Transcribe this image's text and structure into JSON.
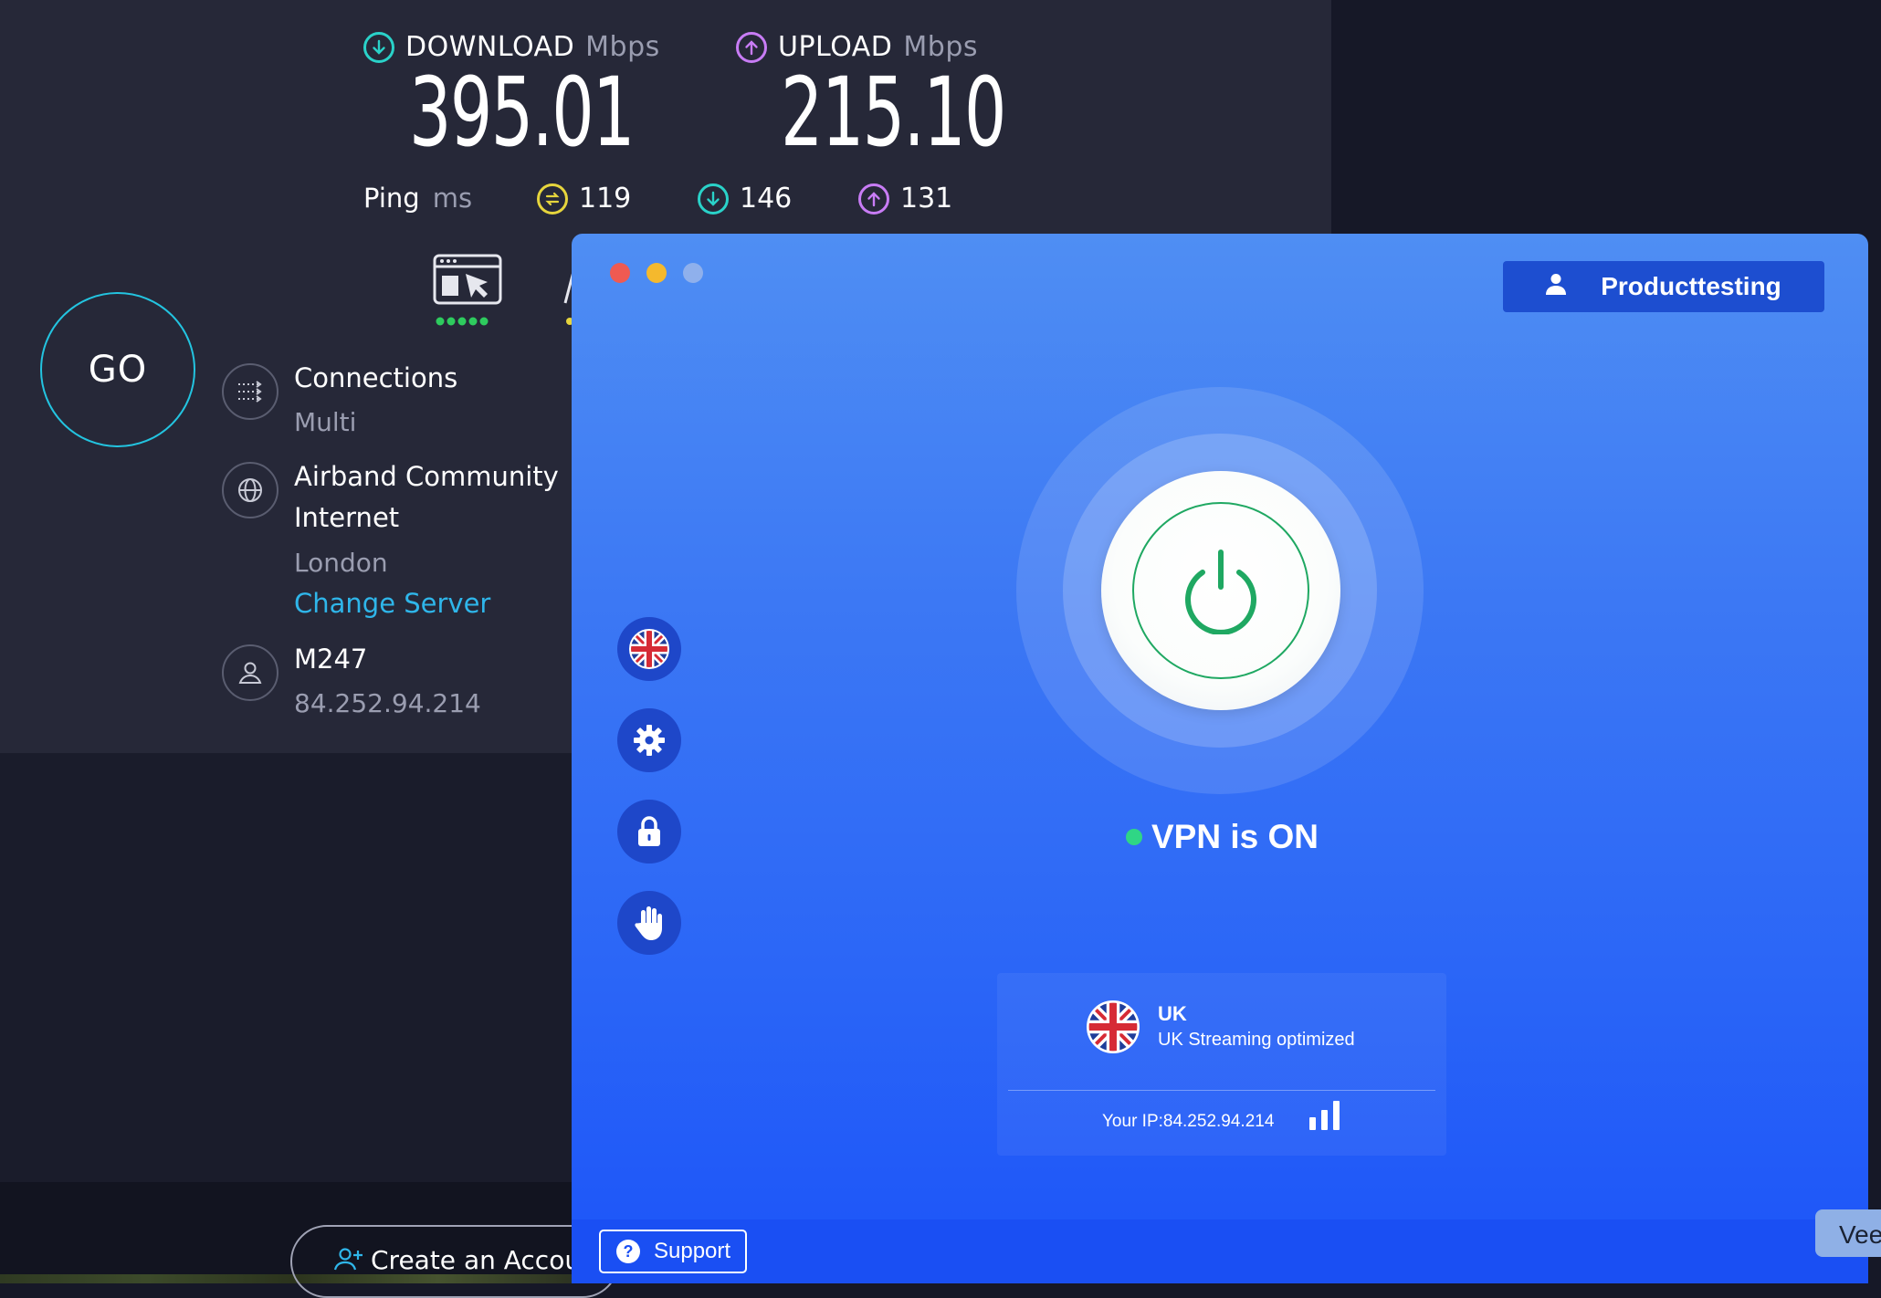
{
  "speedtest": {
    "download": {
      "label": "DOWNLOAD",
      "unit": "Mbps",
      "value": "395.01"
    },
    "upload": {
      "label": "UPLOAD",
      "unit": "Mbps",
      "value": "215.10"
    },
    "ping": {
      "label": "Ping",
      "unit": "ms",
      "idle": "119",
      "download": "146",
      "upload": "131"
    },
    "go_label": "GO",
    "connections": {
      "title": "Connections",
      "value": "Multi"
    },
    "server": {
      "title": "Airband Community Internet",
      "location": "London",
      "change_link": "Change Server"
    },
    "provider": {
      "title": "M247",
      "ip": "84.252.94.214"
    },
    "create_account": "Create an Accour",
    "colors": {
      "download": "#2ad2c9",
      "upload": "#c87cf5",
      "idle": "#e6d53d",
      "go_ring": "#23c4e0",
      "link": "#2fb6ea"
    }
  },
  "vpn": {
    "user_button": "Producttesting",
    "status": "VPN is ON",
    "server": {
      "name": "UK",
      "description": "UK Streaming optimized",
      "ip_label": "Your IP:84.252.94.214"
    },
    "sidebar_icons": [
      "uk-flag-icon",
      "gear-icon",
      "lock-icon",
      "hand-icon"
    ],
    "support": "Support",
    "colors": {
      "accent": "#2b66f7",
      "on": "#2fd685",
      "power": "#1fa862"
    }
  },
  "edge_tab": "Vee"
}
